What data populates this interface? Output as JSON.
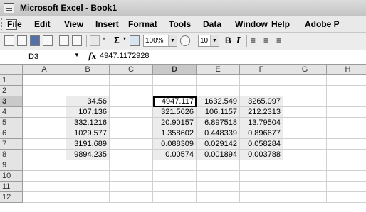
{
  "window": {
    "title": "Microsoft Excel - Book1"
  },
  "menus": [
    {
      "label": "File",
      "u": "F",
      "rest": "ile"
    },
    {
      "label": "Edit",
      "u": "E",
      "rest": "dit"
    },
    {
      "label": "View",
      "u": "V",
      "rest": "iew"
    },
    {
      "label": "Insert",
      "u": "I",
      "rest": "nsert"
    },
    {
      "label": "Format",
      "pre": "F",
      "u": "o",
      "rest": "rmat"
    },
    {
      "label": "Tools",
      "u": "T",
      "rest": "ools"
    },
    {
      "label": "Data",
      "u": "D",
      "rest": "ata"
    },
    {
      "label": "Window",
      "u": "W",
      "rest": "indow"
    },
    {
      "label": "Help",
      "u": "H",
      "rest": "elp"
    },
    {
      "label": "Adobe P",
      "pre": "Ado",
      "u": "b",
      "rest": "e P"
    }
  ],
  "toolbar": {
    "sum_symbol": "Σ",
    "zoom": "100%",
    "font_size": "10",
    "bold": "B",
    "italic": "I",
    "icons": [
      "new-icon",
      "open-icon",
      "save-icon",
      "permission-icon",
      "print-icon",
      "print-preview-icon",
      "undo-icon",
      "autosum-icon",
      "chart-wizard-icon",
      "help-icon",
      "align-left-icon",
      "align-center-icon",
      "align-right-icon"
    ]
  },
  "formula_bar": {
    "name_box": "D3",
    "fx": "fx",
    "value": "4947.1172928"
  },
  "sheet": {
    "columns": [
      "A",
      "B",
      "C",
      "D",
      "E",
      "F",
      "G",
      "H"
    ],
    "rows": [
      "1",
      "2",
      "3",
      "4",
      "5",
      "6",
      "7",
      "8",
      "9",
      "10",
      "11",
      "12"
    ],
    "active_cell": "D3",
    "cells": {
      "B3": "34.56",
      "B4": "107.136",
      "B5": "332.1216",
      "B6": "1029.577",
      "B7": "3191.689",
      "B8": "9894.235",
      "D3": "4947.117",
      "D4": "321.5626",
      "D5": "20.90157",
      "D6": "1.358602",
      "D7": "0.088309",
      "D8": "0.00574",
      "E3": "1632.549",
      "E4": "106.1157",
      "E5": "6.897518",
      "E6": "0.448339",
      "E7": "0.029142",
      "E8": "0.001894",
      "F3": "3265.097",
      "F4": "212.2313",
      "F5": "13.79504",
      "F6": "0.896677",
      "F7": "0.058284",
      "F8": "0.003788"
    }
  }
}
